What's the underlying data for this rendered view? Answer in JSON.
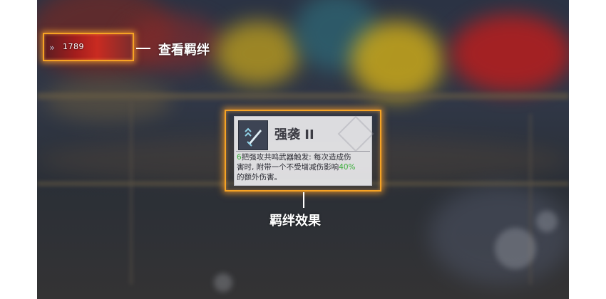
{
  "hud": {
    "bond_count": "1789",
    "bond_icon": "double-chevron-icon"
  },
  "annotations": {
    "view_bonds": "查看羁绊",
    "bond_effect": "羁绊效果"
  },
  "card": {
    "icon": "sword-arrows-icon",
    "title": "强袭 II",
    "desc": {
      "line1_num": "6",
      "line1_text": "把强攻共鸣武器触发: 每次造成伤",
      "line2_text": "害时, 附带一个不受增减伤影响",
      "line2_pct": "40%",
      "line3_text": "的额外伤害。"
    }
  },
  "colors": {
    "highlight": "#f6a324",
    "positive": "#3cae3c"
  }
}
